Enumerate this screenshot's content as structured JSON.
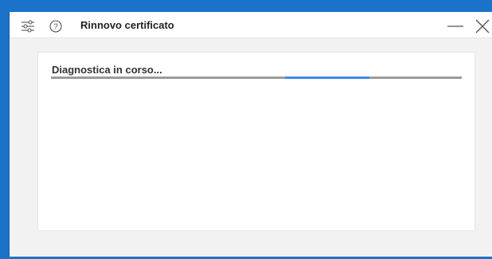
{
  "window": {
    "title": "Rinnovo certificato",
    "icons": {
      "settings": "settings-sliders-icon",
      "help": "help-icon",
      "minimize": "minimize-icon",
      "close": "close-icon"
    }
  },
  "main": {
    "status_text": "Diagnostica in corso...",
    "progress": {
      "type": "indeterminate",
      "indicator_start_fraction": 0.57,
      "indicator_length_fraction": 0.205
    }
  },
  "colors": {
    "desktop_background": "#1a73c8",
    "window_background": "#f2f2f2",
    "progress_track": "#9b9b9b",
    "progress_indicator": "#3c8ae6"
  }
}
